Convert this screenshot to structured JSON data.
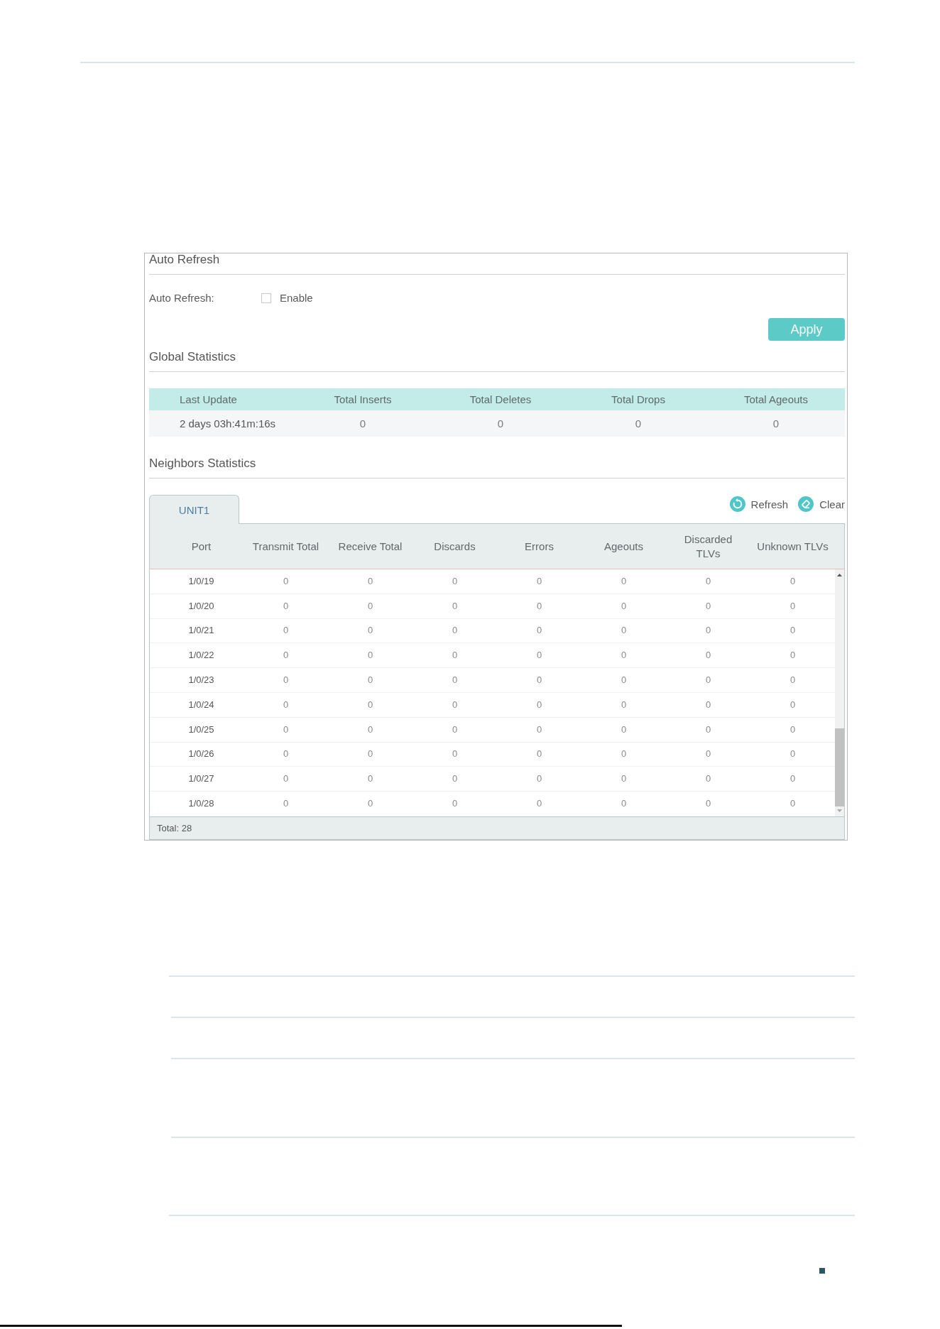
{
  "auto_refresh": {
    "title": "Auto Refresh",
    "label": "Auto Refresh:",
    "checkbox": {
      "label": "Enable",
      "checked": false
    },
    "apply_button": {
      "label": "Apply"
    }
  },
  "global_statistics": {
    "title": "Global Statistics",
    "columns": [
      "Last Update",
      "Total Inserts",
      "Total Deletes",
      "Total Drops",
      "Total Ageouts"
    ],
    "rows": [
      [
        "2 days 03h:41m:16s",
        "0",
        "0",
        "0",
        "0"
      ]
    ]
  },
  "neighbors_statistics": {
    "title": "Neighbors Statistics",
    "tabs": [
      {
        "label": "UNIT1",
        "selected": true
      }
    ],
    "actions": [
      {
        "kind": "refresh",
        "label": "Refresh"
      },
      {
        "kind": "clear",
        "label": "Clear"
      }
    ],
    "columns": [
      "Port",
      "Transmit Total",
      "Receive Total",
      "Discards",
      "Errors",
      "Ageouts",
      "Discarded TLVs",
      "Unknown TLVs"
    ],
    "rows": [
      [
        "1/0/19",
        "0",
        "0",
        "0",
        "0",
        "0",
        "0",
        "0"
      ],
      [
        "1/0/20",
        "0",
        "0",
        "0",
        "0",
        "0",
        "0",
        "0"
      ],
      [
        "1/0/21",
        "0",
        "0",
        "0",
        "0",
        "0",
        "0",
        "0"
      ],
      [
        "1/0/22",
        "0",
        "0",
        "0",
        "0",
        "0",
        "0",
        "0"
      ],
      [
        "1/0/23",
        "0",
        "0",
        "0",
        "0",
        "0",
        "0",
        "0"
      ],
      [
        "1/0/24",
        "0",
        "0",
        "0",
        "0",
        "0",
        "0",
        "0"
      ],
      [
        "1/0/25",
        "0",
        "0",
        "0",
        "0",
        "0",
        "0",
        "0"
      ],
      [
        "1/0/26",
        "0",
        "0",
        "0",
        "0",
        "0",
        "0",
        "0"
      ],
      [
        "1/0/27",
        "0",
        "0",
        "0",
        "0",
        "0",
        "0",
        "0"
      ],
      [
        "1/0/28",
        "0",
        "0",
        "0",
        "0",
        "0",
        "0",
        "0"
      ]
    ],
    "total": "Total: 28"
  }
}
